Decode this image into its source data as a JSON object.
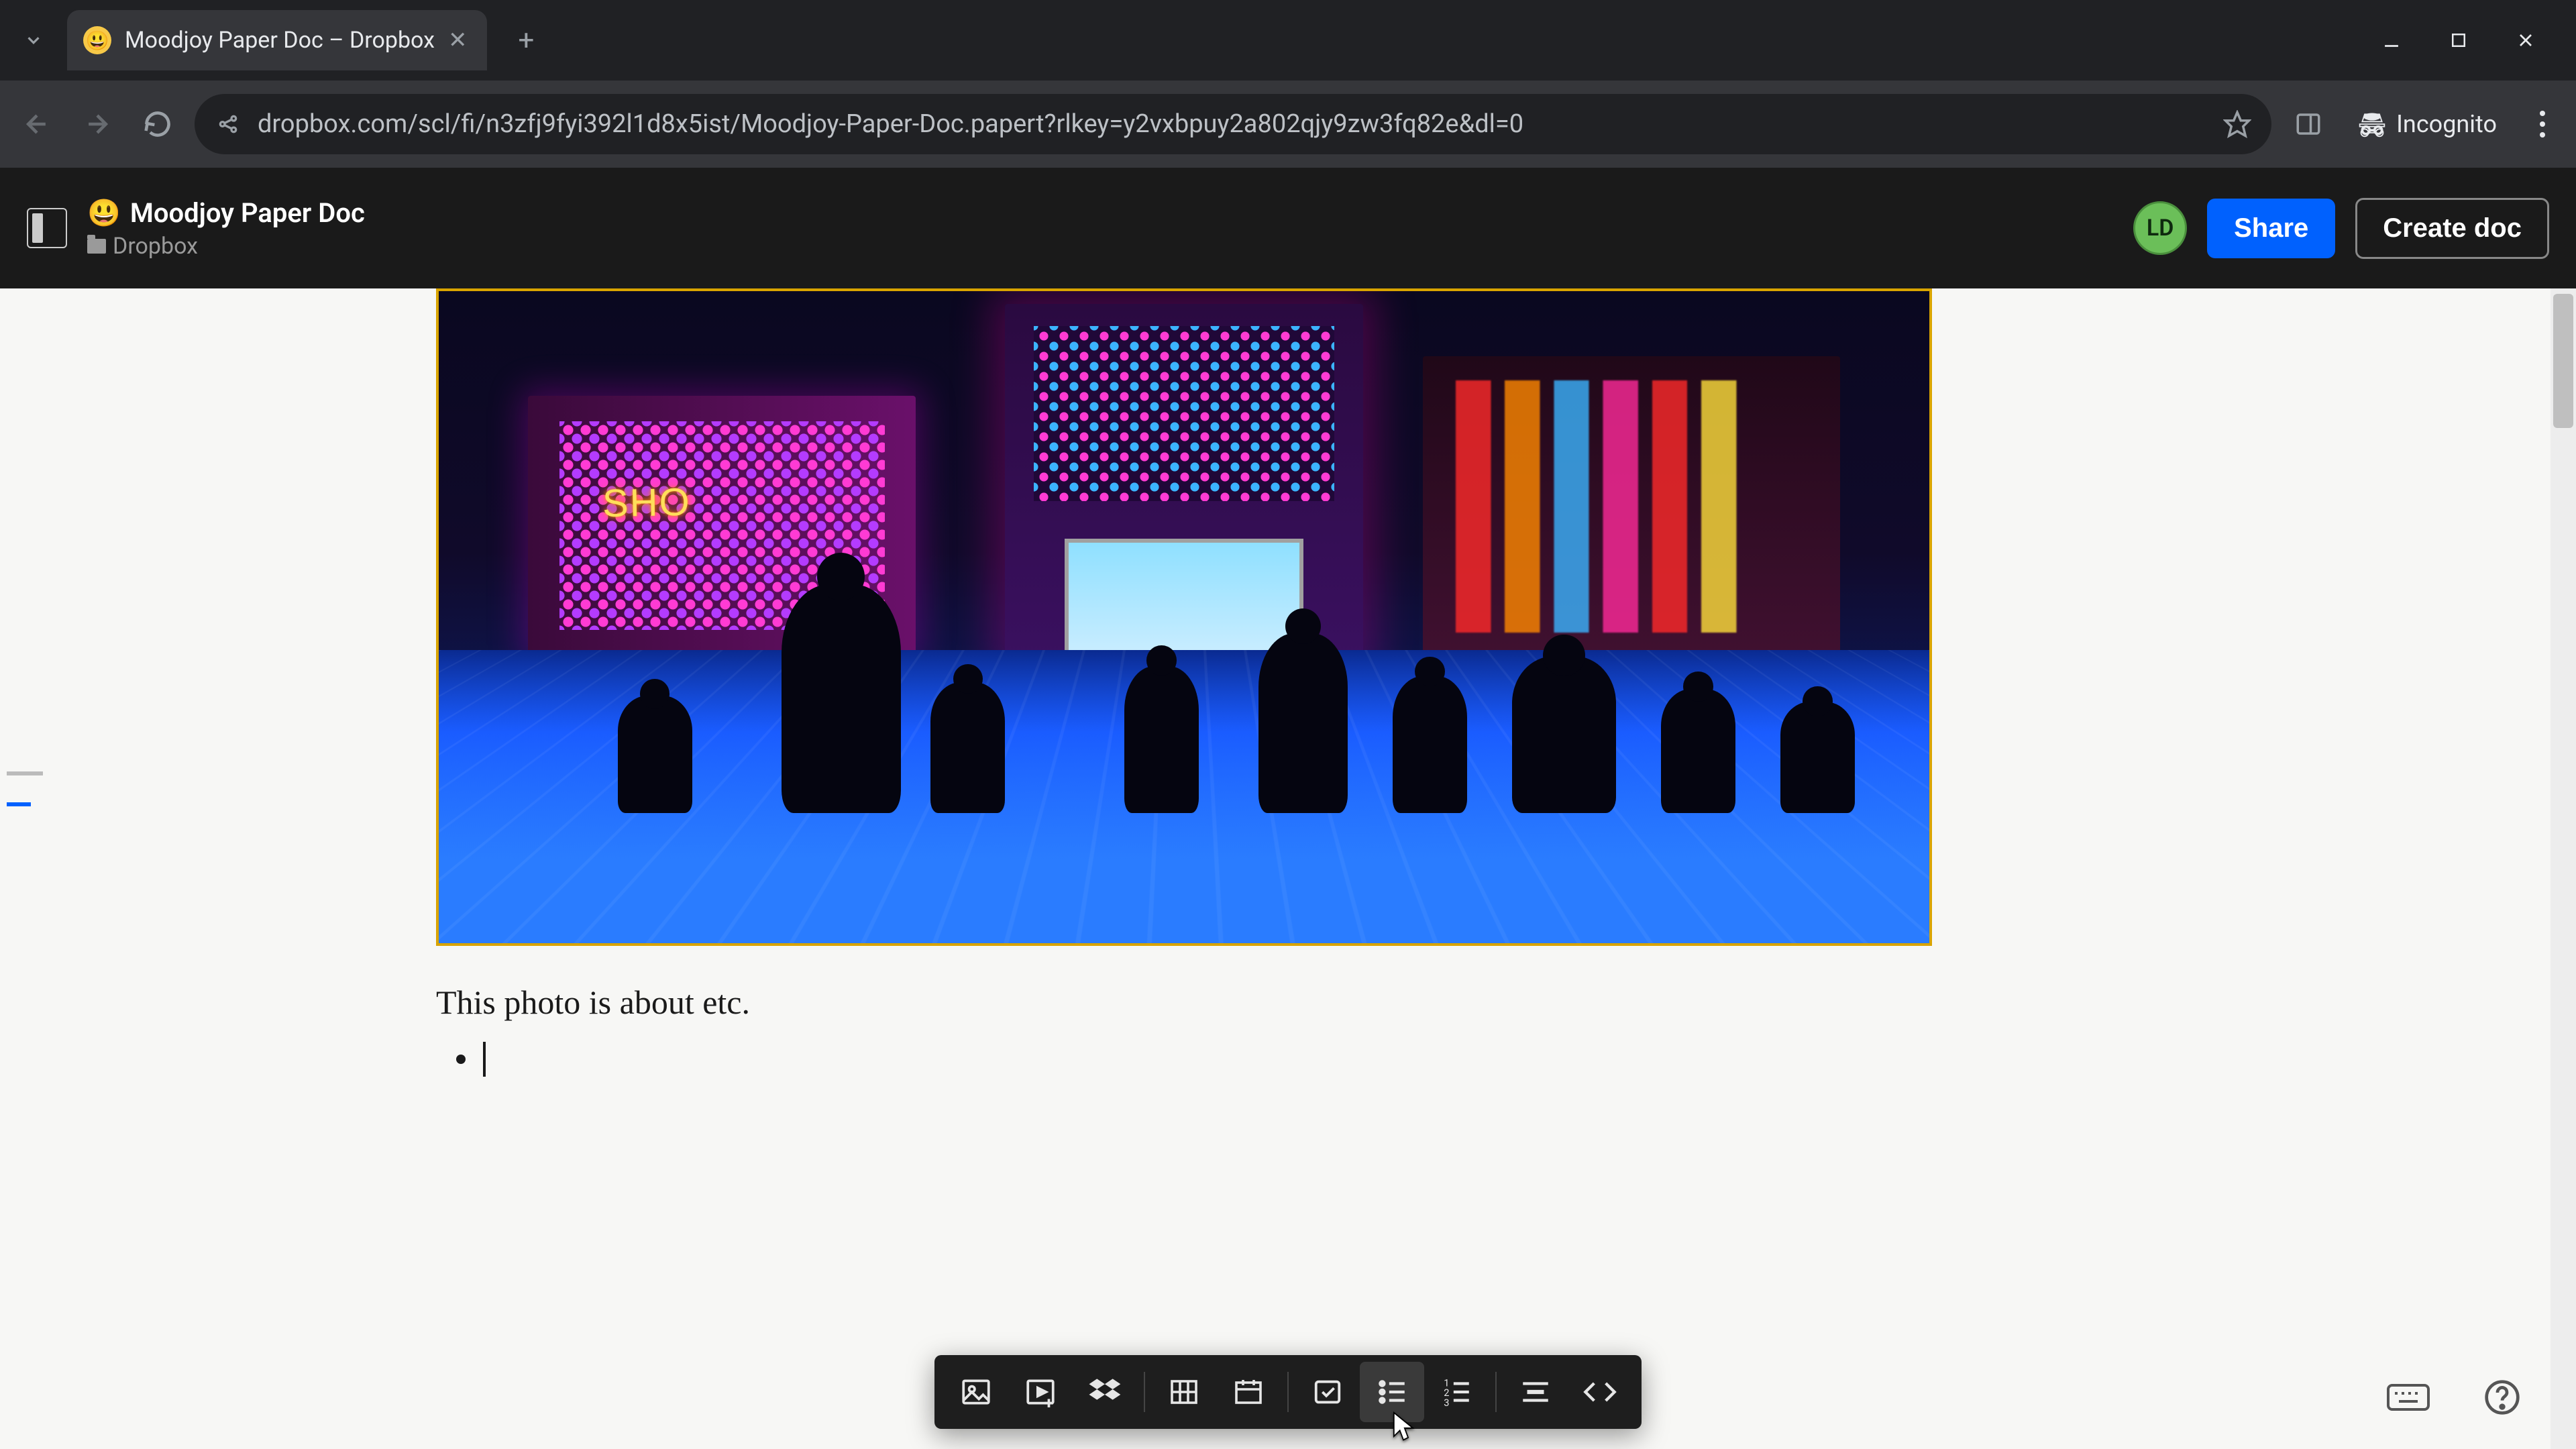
{
  "browser": {
    "tab_title": "Moodjoy Paper Doc – Dropbox",
    "url": "dropbox.com/scl/fi/n3zfj9fyi392l1d8x5ist/Moodjoy-Paper-Doc.papert?rlkey=y2vxbpuy2a802qjy9zw3fq82e&dl=0",
    "incognito_label": "Incognito"
  },
  "header": {
    "doc_emoji": "😃",
    "doc_title": "Moodjoy Paper Doc",
    "breadcrumb": "Dropbox",
    "avatar_initials": "LD",
    "share_label": "Share",
    "create_label": "Create doc"
  },
  "image": {
    "shop_sign": "SHO"
  },
  "doc": {
    "caption": "This photo is about etc."
  },
  "toolbar": {
    "items": [
      {
        "name": "image",
        "label": "Add image"
      },
      {
        "name": "video",
        "label": "Add video"
      },
      {
        "name": "dropbox",
        "label": "Dropbox file"
      },
      {
        "name": "table",
        "label": "Table"
      },
      {
        "name": "timeline",
        "label": "Timeline"
      },
      {
        "name": "checklist",
        "label": "To-do list"
      },
      {
        "name": "bulleted",
        "label": "Bulleted list",
        "active": true
      },
      {
        "name": "numbered",
        "label": "Numbered list"
      },
      {
        "name": "divider",
        "label": "Divider"
      },
      {
        "name": "code",
        "label": "Code block"
      }
    ]
  }
}
